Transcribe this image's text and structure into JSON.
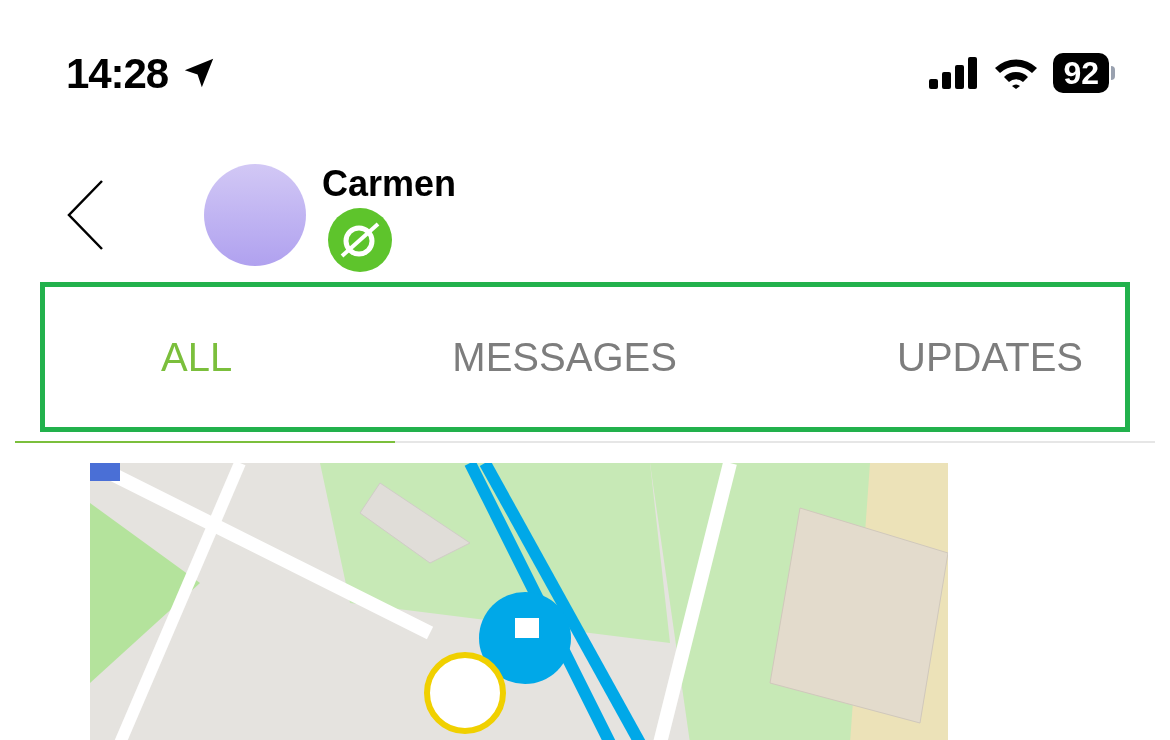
{
  "status_bar": {
    "time": "14:28",
    "battery": "92"
  },
  "header": {
    "name": "Carmen"
  },
  "tabs": [
    {
      "label": "ALL",
      "selected": true
    },
    {
      "label": "MESSAGES",
      "selected": false
    },
    {
      "label": "UPDATES",
      "selected": false
    }
  ]
}
